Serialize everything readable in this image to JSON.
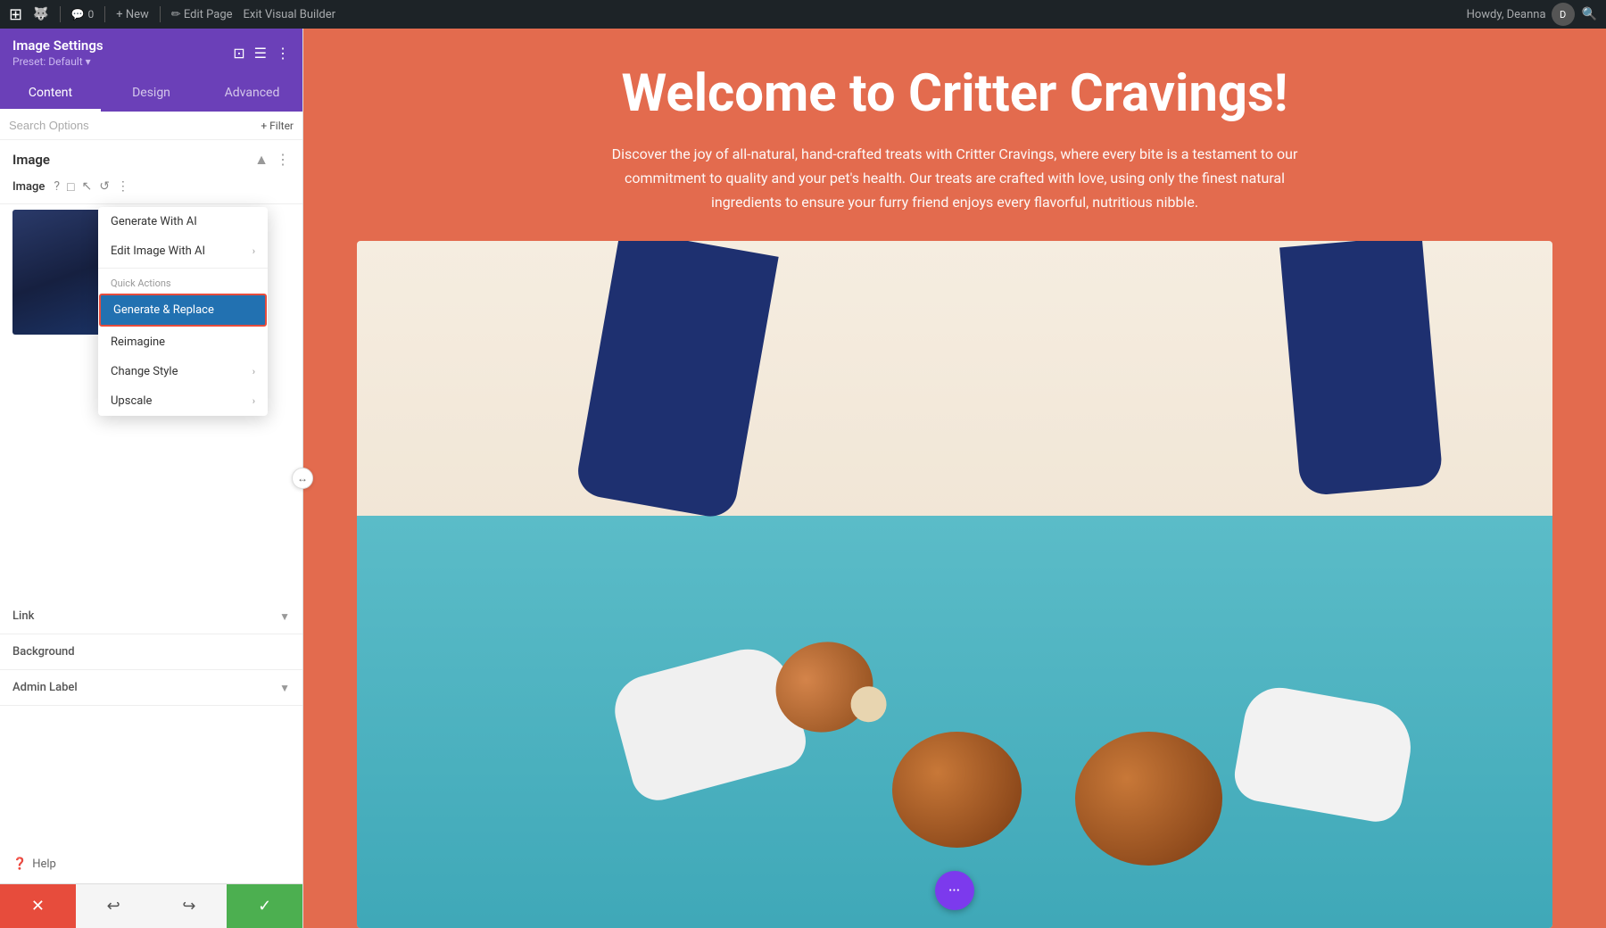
{
  "adminBar": {
    "wpLogo": "⊞",
    "commentIcon": "💬",
    "commentCount": "0",
    "newLabel": "+ New",
    "editPageLabel": "✏ Edit Page",
    "exitVisualLabel": "Exit Visual Builder",
    "howdyLabel": "Howdy, Deanna",
    "searchIcon": "🔍"
  },
  "sidebar": {
    "title": "Image Settings",
    "preset": "Preset: Default ▾",
    "tabs": [
      {
        "label": "Content",
        "active": true
      },
      {
        "label": "Design",
        "active": false
      },
      {
        "label": "Advanced",
        "active": false
      }
    ],
    "search": {
      "placeholder": "Search Options"
    },
    "filterLabel": "+ Filter",
    "section": {
      "title": "Image",
      "collapseIcon": "▲"
    },
    "imageRow": {
      "label": "Image",
      "icons": [
        "?",
        "□",
        "↖",
        "↺",
        "⋮"
      ]
    },
    "contextMenu": {
      "generateWithAI": "Generate With AI",
      "editImageWithAI": "Edit Image With AI",
      "quickActionsLabel": "Quick Actions",
      "generateReplace": "Generate & Replace",
      "reimagine": "Reimagine",
      "changeStyle": "Change Style",
      "upscale": "Upscale"
    },
    "linkSection": "Link",
    "backgroundSection": "Background",
    "adminLabelSection": "Admin Label",
    "helpLabel": "Help"
  },
  "bottomBar": {
    "cancelIcon": "✕",
    "undoIcon": "↩",
    "redoIcon": "↪",
    "saveIcon": "✓"
  },
  "mainContent": {
    "heroTitle": "Welcome to Critter Cravings!",
    "heroSubtitle": "Discover the joy of all-natural, hand-crafted treats with Critter Cravings, where every bite is a testament to our commitment to quality and your pet's health. Our treats are crafted with love, using only the finest natural ingredients to ensure your furry friend enjoys every flavorful, nutritious nibble.",
    "fabIcon": "•••"
  }
}
